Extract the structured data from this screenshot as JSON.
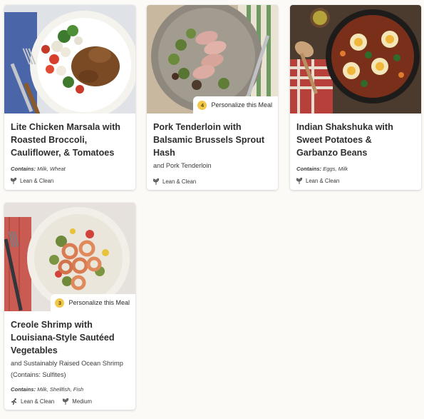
{
  "meals": [
    {
      "title": "Lite Chicken Marsala with Roasted Broccoli, Cauliflower, & Tomatoes",
      "subtitle": "",
      "contains": "Contains: Milk, Wheat",
      "badge": null,
      "tags": [
        {
          "icon": "leaf-icon",
          "label": "Lean & Clean"
        }
      ]
    },
    {
      "title": "Pork Tenderloin with Balsamic Brussels Sprout Hash",
      "subtitle": "and Pork Tenderloin",
      "contains": "",
      "badge": {
        "count": "4",
        "label": "Personalize this Meal"
      },
      "tags": [
        {
          "icon": "leaf-icon",
          "label": "Lean & Clean"
        }
      ]
    },
    {
      "title": "Indian Shakshuka with Sweet Potatoes & Garbanzo Beans",
      "subtitle": "",
      "contains": "Contains: Eggs, Milk",
      "badge": null,
      "tags": [
        {
          "icon": "leaf-icon",
          "label": "Lean & Clean"
        }
      ]
    },
    {
      "title": "Creole Shrimp with Louisiana-Style Sautéed Vegetables",
      "subtitle": "and Sustainably Raised Ocean Shrimp (Contains: Sulfites)",
      "contains": "Contains: Milk, Shellfish, Fish",
      "badge": {
        "count": "3",
        "label": "Personalize this Meal"
      },
      "tags": [
        {
          "icon": "running-icon",
          "label": "Lean & Clean"
        },
        {
          "icon": "pepper-icon",
          "label": "Medium"
        }
      ]
    }
  ],
  "colors": {
    "background": "#fbfaf7",
    "card": "#ffffff",
    "badge_dot": "#f1c84a"
  }
}
